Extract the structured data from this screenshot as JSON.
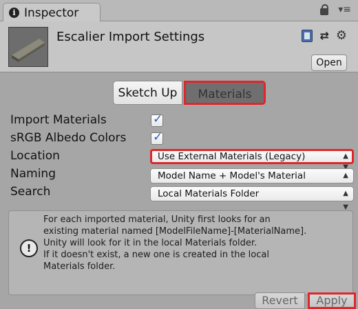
{
  "window": {
    "tab_title": "Inspector",
    "tab_icon": "info-icon",
    "tab_actions": [
      "lock-icon",
      "menu-icon"
    ]
  },
  "header": {
    "title": "Escalier Import Settings",
    "icons": [
      "documentation-book-icon",
      "preset-icon",
      "gear-icon"
    ],
    "open_label": "Open"
  },
  "tabs": {
    "items": [
      "Sketch Up",
      "Materials"
    ],
    "active": "Materials"
  },
  "properties": {
    "import_materials": {
      "label": "Import Materials",
      "checked": true
    },
    "srgb_albedo": {
      "label": "sRGB Albedo Colors",
      "checked": true
    },
    "location": {
      "label": "Location",
      "value": "Use External Materials (Legacy)"
    },
    "naming": {
      "label": "Naming",
      "value": "Model Name + Model's Material"
    },
    "search": {
      "label": "Search",
      "value": "Local Materials Folder"
    }
  },
  "help": {
    "icon": "warning-icon",
    "lines": [
      "For each imported material, Unity first looks for an",
      "existing material named [ModelFileName]-[MaterialName].",
      "Unity will look for it in the local Materials folder.",
      "If it doesn't exist, a new one is created in the local",
      "Materials folder."
    ]
  },
  "footer": {
    "revert_label": "Revert",
    "apply_label": "Apply"
  },
  "colors": {
    "highlight": "#e0262a",
    "checkmark": "#2a5bb8",
    "panel_bg": "#a6a6a6"
  }
}
